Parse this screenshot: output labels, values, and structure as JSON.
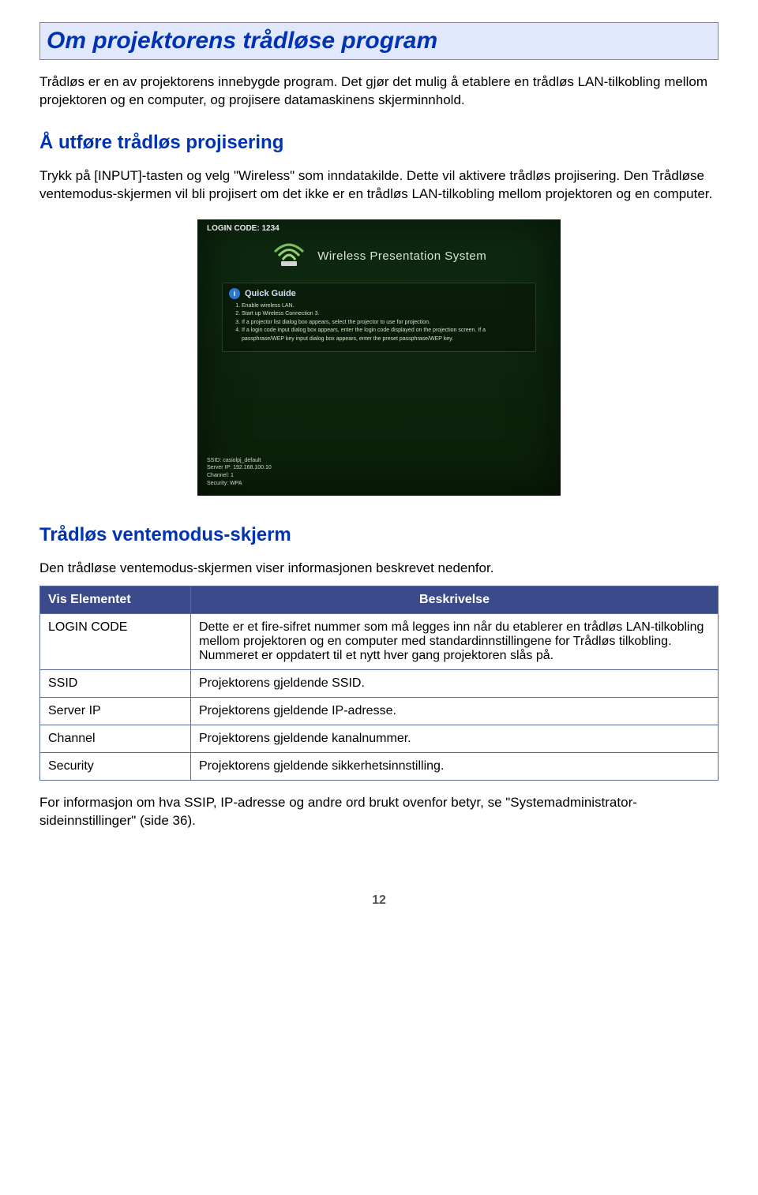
{
  "header": {
    "title": "Om projektorens trådløse program"
  },
  "intro": "Trådløs er en av projektorens innebygde program. Det gjør det mulig å etablere en trådløs LAN-tilkobling mellom projektoren og en computer, og projisere datamaskinens skjerminnhold.",
  "section1": {
    "title": "Å utføre trådløs projisering",
    "body": "Trykk på [INPUT]-tasten og velg \"Wireless\" som inndatakilde. Dette vil aktivere trådløs projisering. Den Trådløse ventemodus-skjermen vil bli projisert om det ikke er en trådløs LAN-tilkobling mellom projektoren og en computer."
  },
  "figure": {
    "login_code": "LOGIN CODE: 1234",
    "wps_title": "Wireless Presentation System",
    "quick_guide_label": "Quick Guide",
    "steps": [
      "Enable wireless LAN.",
      "Start up Wireless Connection 3.",
      "If a projector list dialog box appears, select the projector to use for projection.",
      "If a login code input dialog box appears, enter the login code displayed on the projection screen. If a passphrase/WEP key input dialog box appears, enter the preset passphrase/WEP key."
    ],
    "footer": {
      "ssid": "SSID: casiolpj_default",
      "server_ip": "Server IP: 192.168.100.10",
      "channel": "Channel: 1",
      "security": "Security: WPA"
    }
  },
  "section2": {
    "title": "Trådløs ventemodus-skjerm",
    "intro": "Den trådløse ventemodus-skjermen viser informasjonen beskrevet nedenfor."
  },
  "table": {
    "head": {
      "col1": "Vis Elementet",
      "col2": "Beskrivelse"
    },
    "rows": [
      {
        "k": "LOGIN CODE",
        "v": "Dette er et fire-sifret nummer som må legges inn når du etablerer en trådløs LAN-tilkobling mellom projektoren og en computer med standardinnstillingene for Trådløs tilkobling.\nNummeret er oppdatert til et nytt hver gang projektoren slås på."
      },
      {
        "k": "SSID",
        "v": "Projektorens gjeldende SSID."
      },
      {
        "k": "Server IP",
        "v": "Projektorens gjeldende IP-adresse."
      },
      {
        "k": "Channel",
        "v": "Projektorens gjeldende kanalnummer."
      },
      {
        "k": "Security",
        "v": "Projektorens gjeldende sikkerhetsinnstilling."
      }
    ]
  },
  "footnote": "For informasjon om hva SSIP, IP-adresse og andre ord brukt ovenfor betyr, se \"Systemadministrator-sideinnstillinger\" (side 36).",
  "page_number": "12"
}
